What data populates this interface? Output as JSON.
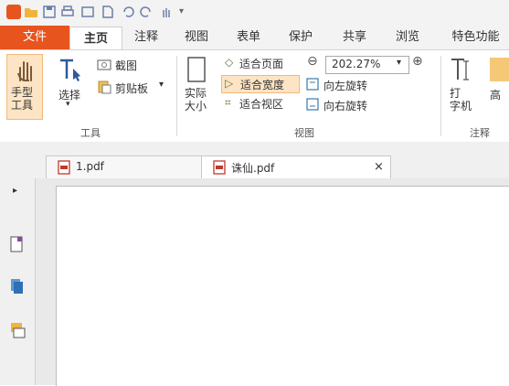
{
  "ribbon_tabs": [
    "文件",
    "主页",
    "注释",
    "视图",
    "表单",
    "保护",
    "共享",
    "浏览",
    "特色功能"
  ],
  "tools": {
    "hand": "手型\n工具",
    "select": "选择",
    "screenshot": "截图",
    "clipboard": "剪贴板",
    "group_tools": "工具",
    "actual_size": "实际\n大小",
    "fit_page": "适合页面",
    "fit_width": "适合宽度",
    "fit_view": "适合视区",
    "zoom_value": "202.27%",
    "rotate_left": "向左旋转",
    "rotate_right": "向右旋转",
    "group_view": "视图",
    "typewriter": "打\n字机",
    "highlight": "高",
    "group_annotate": "注释"
  },
  "doc_tabs": [
    {
      "label": "1.pdf"
    },
    {
      "label": "诛仙.pdf",
      "close": "×"
    }
  ],
  "colors": {
    "accent": "#e8541e",
    "tab_border": "#cfcfcf"
  }
}
